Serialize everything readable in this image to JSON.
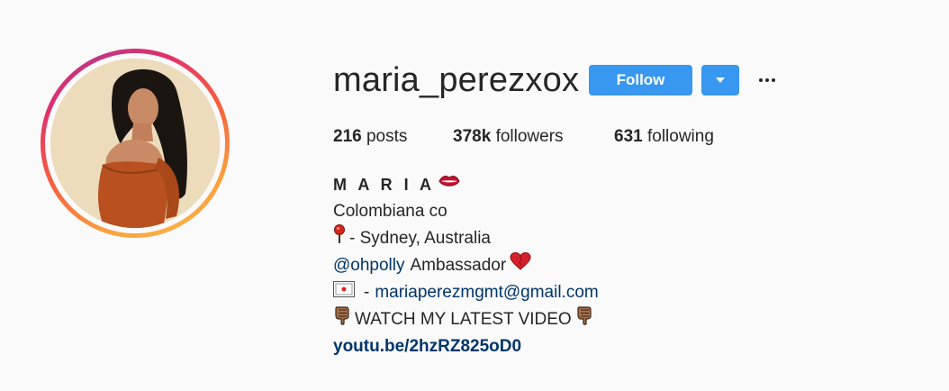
{
  "profile": {
    "username": "maria_perezxox",
    "follow_label": "Follow",
    "stats": {
      "posts_count": "216",
      "posts_label": "posts",
      "followers_count": "378k",
      "followers_label": "followers",
      "following_count": "631",
      "following_label": "following"
    },
    "bio": {
      "full_name": "M A R I A",
      "line1": "Colombiana co",
      "location": "- Sydney, Australia",
      "mention": "@ohpolly",
      "mention_suffix": "Ambassador",
      "email_prefix": "-",
      "email": "mariaperezmgmt@gmail.com",
      "watch": "WATCH MY LATEST VIDEO",
      "website": "youtu.be/2hzRZ825oD0"
    }
  },
  "icons": {
    "lips": "lips-icon",
    "pin": "round-pushpin-icon",
    "heart": "heart-icon",
    "envelope": "envelope-icon",
    "pointing_down": "pointing-down-icon",
    "more": "ellipsis-icon",
    "dropdown": "chevron-down-icon"
  },
  "colors": {
    "follow_button": "#3897f0",
    "link": "#003569",
    "text": "#262626",
    "background": "#fafafa"
  }
}
